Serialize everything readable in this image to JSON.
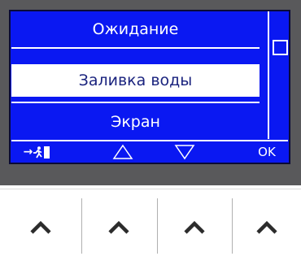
{
  "menu": {
    "items": [
      {
        "label": "Ожидание",
        "selected": false
      },
      {
        "label": "Заливка воды",
        "selected": true
      },
      {
        "label": "Экран",
        "selected": false
      }
    ]
  },
  "softkeys": {
    "exit_arrow": "→",
    "exit_icon": "exit-door-icon",
    "up_icon": "triangle-up-icon",
    "down_icon": "triangle-down-icon",
    "ok_label": "OK"
  },
  "hardware_buttons": {
    "icons": [
      "chevron-up-icon",
      "chevron-up-icon",
      "chevron-up-icon",
      "chevron-up-icon"
    ]
  },
  "colors": {
    "bezel": "#59595b",
    "lcd_background": "#0a18f2",
    "lcd_foreground": "#ffffff",
    "selected_text": "#1a237e"
  }
}
